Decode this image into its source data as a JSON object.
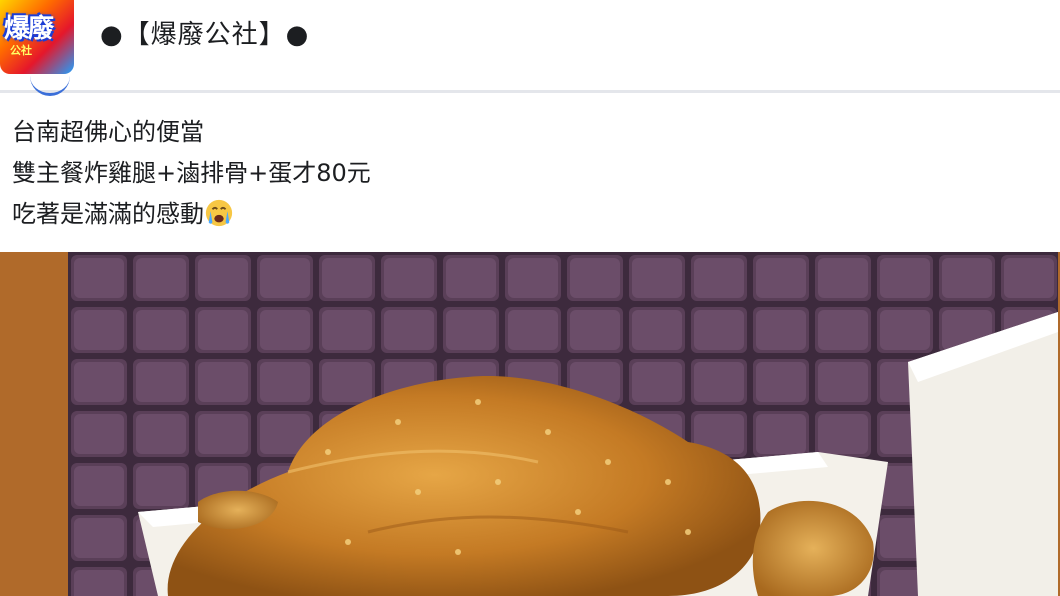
{
  "header": {
    "page_name": "●【爆廢公社】●",
    "avatar_text": "爆廢",
    "avatar_subtext": "公社"
  },
  "post": {
    "lines": [
      "台南超佛心的便當",
      "雙主餐炸雞腿+滷排骨+蛋才80元",
      "吃著是滿滿的感動"
    ],
    "emoji": "crying-face-emoji"
  },
  "photo": {
    "description_icon": "bento-photo"
  },
  "colors": {
    "wall": "#4a3249",
    "frame": "#b06a2a",
    "box": "#f4f1ea",
    "chicken": "#c8822c"
  }
}
